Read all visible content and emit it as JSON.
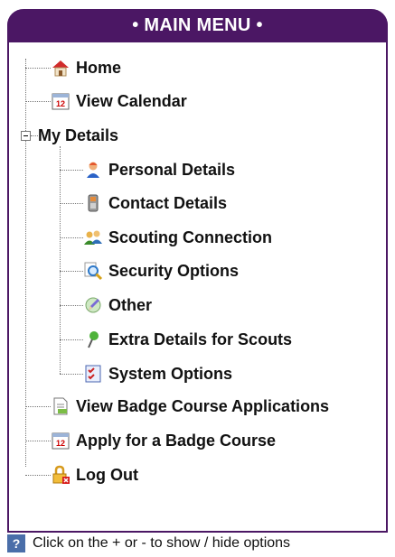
{
  "menu": {
    "title": "• MAIN MENU •",
    "items": {
      "home": "Home",
      "view_calendar": "View Calendar",
      "my_details": "My Details",
      "personal_details": "Personal Details",
      "contact_details": "Contact Details",
      "scouting_connection": "Scouting Connection",
      "security_options": "Security Options",
      "other": "Other",
      "extra_details": "Extra Details for Scouts",
      "system_options": "System Options",
      "view_badge_apps": "View Badge Course Applications",
      "apply_badge": "Apply for a Badge Course",
      "log_out": "Log Out"
    }
  },
  "footer": {
    "hint": "Click on the + or - to show / hide options"
  },
  "colors": {
    "brand": "#4b1764"
  }
}
